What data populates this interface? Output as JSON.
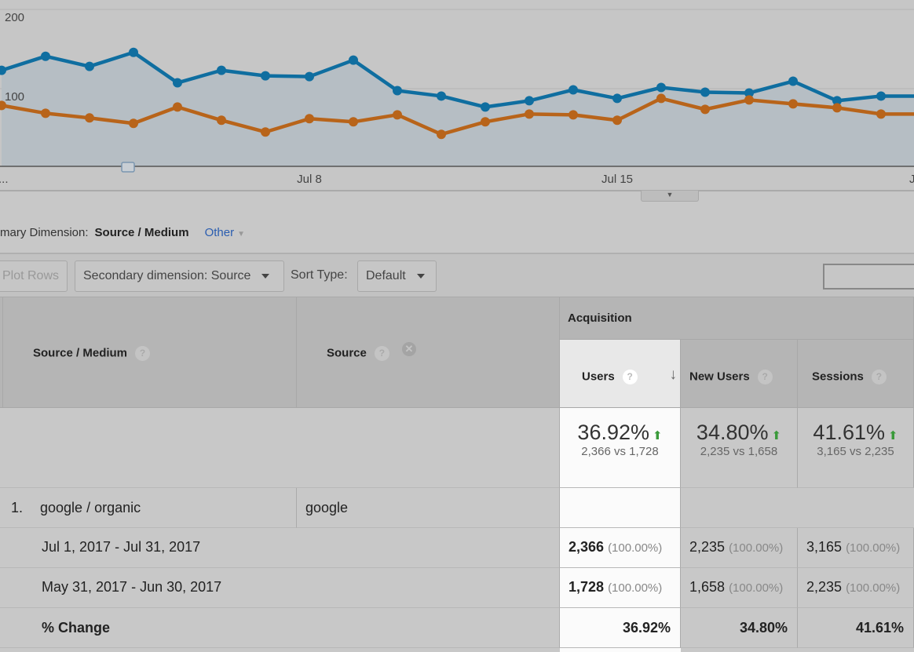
{
  "chart_data": {
    "type": "line",
    "x": [
      "Jul 1",
      "Jul 2",
      "Jul 3",
      "Jul 4",
      "Jul 5",
      "Jul 6",
      "Jul 7",
      "Jul 8",
      "Jul 9",
      "Jul 10",
      "Jul 11",
      "Jul 12",
      "Jul 13",
      "Jul 14",
      "Jul 15",
      "Jul 16",
      "Jul 17",
      "Jul 18",
      "Jul 19",
      "Jul 20",
      "Jul 21"
    ],
    "series": [
      {
        "color": "#0f6ea0",
        "values": [
          123,
          141,
          128,
          146,
          107,
          123,
          116,
          115,
          136,
          97,
          90,
          76,
          84,
          98,
          87,
          101,
          95,
          94,
          109,
          84,
          90
        ]
      },
      {
        "color": "#b8641a",
        "values": [
          78,
          68,
          62,
          55,
          76,
          59,
          44,
          61,
          57,
          66,
          41,
          57,
          67,
          66,
          59,
          87,
          73,
          85,
          80,
          75,
          67
        ]
      }
    ],
    "yticks": [
      "100",
      "200"
    ],
    "ylim": [
      0,
      200
    ],
    "xtick_labels": {
      "first": "...",
      "jul8": "Jul 8",
      "jul15": "Jul 15",
      "last": "J"
    },
    "grid": true
  },
  "dimension": {
    "label": "mary Dimension:",
    "value": "Source / Medium",
    "other": "Other"
  },
  "toolbar": {
    "plot_rows": "Plot Rows",
    "secondary": "Secondary dimension: Source",
    "sort_label": "Sort Type:",
    "sort_value": "Default"
  },
  "table": {
    "col_source_medium": "Source / Medium",
    "col_source": "Source",
    "group": "Acquisition",
    "metrics": [
      {
        "name": "Users",
        "total_pct": "36.92%",
        "total_cmp": "2,366 vs 1,728",
        "cur": "2,366",
        "cur_pct": "(100.00%)",
        "prev": "1,728",
        "prev_pct": "(100.00%)",
        "change": "36.92%"
      },
      {
        "name": "New Users",
        "total_pct": "34.80%",
        "total_cmp": "2,235 vs 1,658",
        "cur": "2,235",
        "cur_pct": "(100.00%)",
        "prev": "1,658",
        "prev_pct": "(100.00%)",
        "change": "34.80%"
      },
      {
        "name": "Sessions",
        "total_pct": "41.61%",
        "total_cmp": "3,165 vs 2,235",
        "cur": "3,165",
        "cur_pct": "(100.00%)",
        "prev": "2,235",
        "prev_pct": "(100.00%)",
        "change": "41.61%"
      }
    ],
    "row": {
      "index": "1.",
      "source_medium": "google / organic",
      "source": "google"
    },
    "range_cur": "Jul 1, 2017 - Jul 31, 2017",
    "range_prev": "May 31, 2017 - Jun 30, 2017",
    "change_label": "% Change"
  }
}
